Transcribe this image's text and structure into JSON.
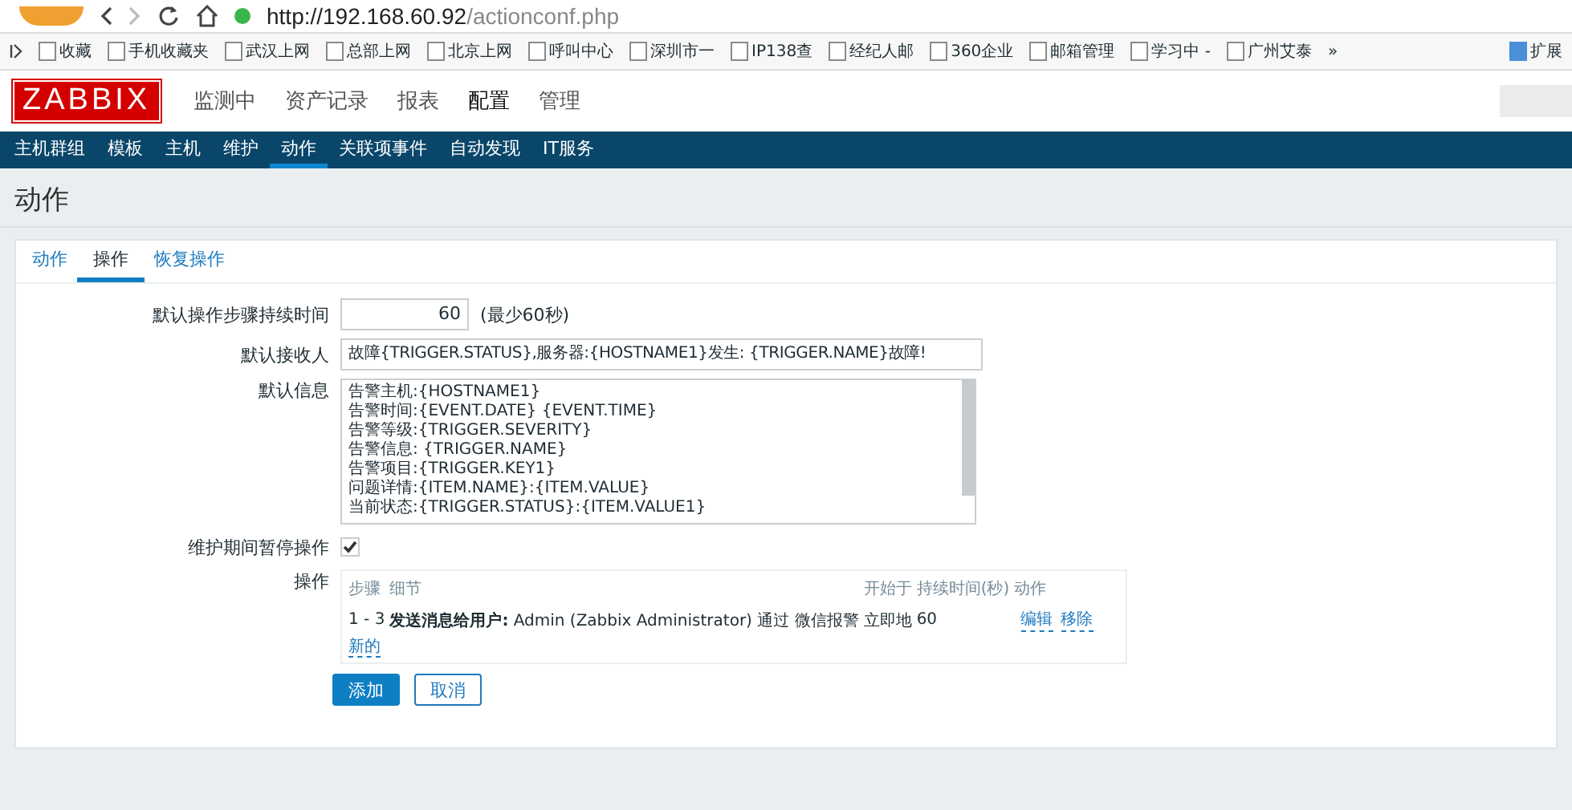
{
  "browser": {
    "url_host": "http://192.168.60.92",
    "url_path": "/actionconf.php",
    "bookmarks": [
      {
        "label": "收藏"
      },
      {
        "label": "手机收藏夹"
      },
      {
        "label": "武汉上网"
      },
      {
        "label": "总部上网"
      },
      {
        "label": "北京上网"
      },
      {
        "label": "呼叫中心"
      },
      {
        "label": "深圳市一"
      },
      {
        "label": "IP138查"
      },
      {
        "label": "经纪人邮"
      },
      {
        "label": "360企业"
      },
      {
        "label": "邮箱管理"
      },
      {
        "label": "学习中 -"
      },
      {
        "label": "广州艾泰"
      }
    ],
    "more": "»",
    "extensions": "扩展"
  },
  "logo": "ZABBIX",
  "main_menu": [
    {
      "label": "监测中",
      "selected": false
    },
    {
      "label": "资产记录",
      "selected": false
    },
    {
      "label": "报表",
      "selected": false
    },
    {
      "label": "配置",
      "selected": true
    },
    {
      "label": "管理",
      "selected": false
    }
  ],
  "sub_menu": [
    {
      "label": "主机群组",
      "selected": false
    },
    {
      "label": "模板",
      "selected": false
    },
    {
      "label": "主机",
      "selected": false
    },
    {
      "label": "维护",
      "selected": false
    },
    {
      "label": "动作",
      "selected": true
    },
    {
      "label": "关联项事件",
      "selected": false
    },
    {
      "label": "自动发现",
      "selected": false
    },
    {
      "label": "IT服务",
      "selected": false
    }
  ],
  "page_title": "动作",
  "tabs": [
    {
      "label": "动作",
      "selected": false
    },
    {
      "label": "操作",
      "selected": true
    },
    {
      "label": "恢复操作",
      "selected": false
    }
  ],
  "form": {
    "step_duration": {
      "label": "默认操作步骤持续时间",
      "value": "60",
      "hint": "(最少60秒)"
    },
    "subject": {
      "label": "默认接收人",
      "value": "故障{TRIGGER.STATUS},服务器:{HOSTNAME1}发生: {TRIGGER.NAME}故障!"
    },
    "message": {
      "label": "默认信息",
      "lines": [
        "告警主机:{HOSTNAME1}",
        "告警时间:{EVENT.DATE} {EVENT.TIME}",
        "告警等级:{TRIGGER.SEVERITY}",
        "告警信息: {TRIGGER.NAME}",
        "告警项目:{TRIGGER.KEY1}",
        "问题详情:{ITEM.NAME}:{ITEM.VALUE}",
        "当前状态:{TRIGGER.STATUS}:{ITEM.VALUE1}"
      ]
    },
    "pause": {
      "label": "维护期间暂停操作",
      "checked": true
    },
    "operations": {
      "label": "操作",
      "columns": [
        "步骤",
        "细节",
        "开始于",
        "持续时间(秒)",
        "动作"
      ],
      "rows": [
        {
          "steps": "1 - 3",
          "details": "**发送消息给用户:** Admin (Zabbix Administrator) 通过 微信报警",
          "start": "立即地",
          "duration": "60",
          "actions": [
            "编辑",
            "移除"
          ]
        }
      ],
      "new_link": "新的"
    }
  },
  "buttons": [
    {
      "label": "添加",
      "kind": "primary"
    },
    {
      "label": "取消",
      "kind": "secondary"
    }
  ]
}
